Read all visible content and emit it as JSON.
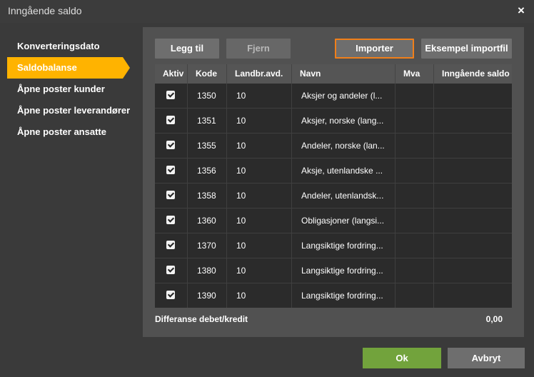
{
  "dialog": {
    "title": "Inngående saldo",
    "close_glyph": "×"
  },
  "sidebar": {
    "items": [
      {
        "label": "Konverteringsdato",
        "active": false
      },
      {
        "label": "Saldobalanse",
        "active": true
      },
      {
        "label": "Åpne poster kunder",
        "active": false
      },
      {
        "label": "Åpne poster leverandører",
        "active": false
      },
      {
        "label": "Åpne poster ansatte",
        "active": false
      }
    ]
  },
  "toolbar": {
    "add_label": "Legg til",
    "remove_label": "Fjern",
    "import_label": "Importer",
    "example_label": "Eksempel importfil"
  },
  "grid": {
    "columns": [
      "Aktiv",
      "Kode",
      "Landbr.avd.",
      "Navn",
      "Mva",
      "Inngående saldo"
    ],
    "rows": [
      {
        "aktiv": true,
        "kode": "1350",
        "landbr": "10",
        "navn": "Aksjer og andeler (l...",
        "mva": "",
        "saldo": ""
      },
      {
        "aktiv": true,
        "kode": "1351",
        "landbr": "10",
        "navn": "Aksjer, norske (lang...",
        "mva": "",
        "saldo": ""
      },
      {
        "aktiv": true,
        "kode": "1355",
        "landbr": "10",
        "navn": "Andeler, norske (lan...",
        "mva": "",
        "saldo": ""
      },
      {
        "aktiv": true,
        "kode": "1356",
        "landbr": "10",
        "navn": "Aksje, utenlandske ...",
        "mva": "",
        "saldo": ""
      },
      {
        "aktiv": true,
        "kode": "1358",
        "landbr": "10",
        "navn": "Andeler, utenlandsk...",
        "mva": "",
        "saldo": ""
      },
      {
        "aktiv": true,
        "kode": "1360",
        "landbr": "10",
        "navn": "Obligasjoner (langsi...",
        "mva": "",
        "saldo": ""
      },
      {
        "aktiv": true,
        "kode": "1370",
        "landbr": "10",
        "navn": "Langsiktige fordring...",
        "mva": "",
        "saldo": ""
      },
      {
        "aktiv": true,
        "kode": "1380",
        "landbr": "10",
        "navn": "Langsiktige fordring...",
        "mva": "",
        "saldo": ""
      },
      {
        "aktiv": true,
        "kode": "1390",
        "landbr": "10",
        "navn": "Langsiktige fordring...",
        "mva": "",
        "saldo": ""
      }
    ]
  },
  "summary": {
    "label": "Differanse debet/kredit",
    "value": "0,00"
  },
  "footer": {
    "ok_label": "Ok",
    "cancel_label": "Avbryt"
  },
  "colors": {
    "accent": "#ffb300",
    "ok": "#72a33c",
    "highlight_border": "#f07f1a"
  }
}
